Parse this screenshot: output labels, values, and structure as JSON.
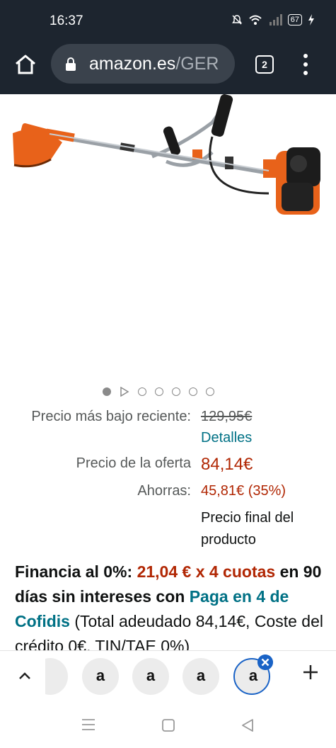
{
  "status_bar": {
    "time": "16:37",
    "battery": "67"
  },
  "browser": {
    "url_host": "amazon.es",
    "url_path": "/GER",
    "tab_count": "2"
  },
  "gallery": {
    "dot_count": 7,
    "active_index": 0
  },
  "pricing": {
    "recent_low_label": "Precio más bajo reciente:",
    "recent_low_value": "129,95€",
    "details_link": "Detalles",
    "offer_label": "Precio de la oferta",
    "offer_value": "84,14€",
    "savings_label": "Ahorras:",
    "savings_value": "45,81€ (35%)",
    "final_note": "Precio final del producto"
  },
  "financing": {
    "lead": "Financia al 0%:",
    "installments": "21,04 € x 4 cuotas",
    "middle": "en 90 días sin intereses con",
    "provider": "Paga en 4 de Cofidis",
    "total_text": "(Total adeudado 84,14€, Coste del crédito 0€, TIN/TAE 0%)"
  },
  "bottom_tabs": {
    "logo_letter": "a"
  },
  "colors": {
    "link": "#007185",
    "price_red": "#b12704",
    "accent_blue": "#1a63c6",
    "top_bar": "#1d252f"
  }
}
